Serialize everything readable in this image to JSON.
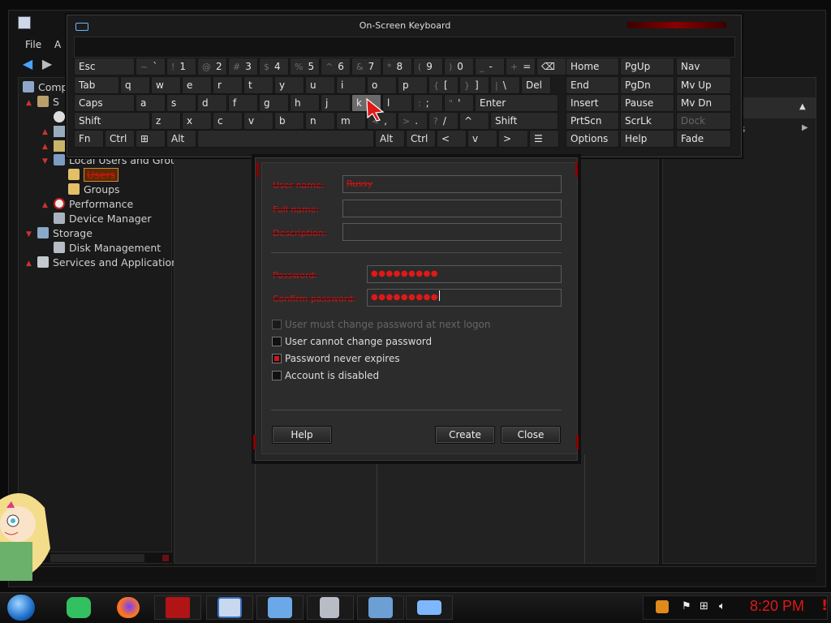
{
  "mmc": {
    "menu": {
      "file": "File",
      "action_partial": "A"
    },
    "tree": [
      {
        "label": "Comp",
        "icon": "computer-management-icon"
      },
      {
        "label": "S",
        "icon": "system-tools-icon"
      },
      {
        "label": "Local Users and Grou",
        "icon": "users-groups-icon"
      },
      {
        "label": "Users",
        "icon": "folder-icon",
        "selected": true
      },
      {
        "label": "Groups",
        "icon": "folder-icon"
      },
      {
        "label": "Performance",
        "icon": "performance-icon"
      },
      {
        "label": "Device Manager",
        "icon": "device-manager-icon"
      },
      {
        "label": "Storage",
        "icon": "storage-icon"
      },
      {
        "label": "Disk Management",
        "icon": "disk-management-icon"
      },
      {
        "label": "Services and Applications",
        "icon": "services-icon"
      }
    ],
    "actions_partial": "s"
  },
  "osk": {
    "title": "On-Screen Keyboard",
    "row1": [
      {
        "main": "Esc"
      },
      {
        "sub": "~",
        "main": "`"
      },
      {
        "sub": "!",
        "main": "1"
      },
      {
        "sub": "@",
        "main": "2"
      },
      {
        "sub": "#",
        "main": "3"
      },
      {
        "sub": "$",
        "main": "4"
      },
      {
        "sub": "%",
        "main": "5"
      },
      {
        "sub": "^",
        "main": "6"
      },
      {
        "sub": "&",
        "main": "7"
      },
      {
        "sub": "*",
        "main": "8"
      },
      {
        "sub": "(",
        "main": "9"
      },
      {
        "sub": ")",
        "main": "0"
      },
      {
        "sub": "_",
        "main": "-"
      },
      {
        "sub": "+",
        "main": "="
      },
      {
        "main": "⌫"
      }
    ],
    "row2": [
      {
        "main": "Tab"
      },
      {
        "main": "q"
      },
      {
        "main": "w"
      },
      {
        "main": "e"
      },
      {
        "main": "r"
      },
      {
        "main": "t"
      },
      {
        "main": "y"
      },
      {
        "main": "u"
      },
      {
        "main": "i"
      },
      {
        "main": "o"
      },
      {
        "main": "p"
      },
      {
        "sub": "{",
        "main": "["
      },
      {
        "sub": "}",
        "main": "]"
      },
      {
        "sub": "|",
        "main": "\\"
      },
      {
        "main": "Del"
      }
    ],
    "row3": [
      {
        "main": "Caps"
      },
      {
        "main": "a"
      },
      {
        "main": "s"
      },
      {
        "main": "d"
      },
      {
        "main": "f"
      },
      {
        "main": "g"
      },
      {
        "main": "h"
      },
      {
        "main": "j"
      },
      {
        "main": "k"
      },
      {
        "main": "l"
      },
      {
        "sub": ":",
        "main": ";"
      },
      {
        "sub": "\"",
        "main": "'"
      },
      {
        "main": "Enter"
      }
    ],
    "row4": [
      {
        "main": "Shift"
      },
      {
        "main": "z"
      },
      {
        "main": "x"
      },
      {
        "main": "c"
      },
      {
        "main": "v"
      },
      {
        "main": "b"
      },
      {
        "main": "n"
      },
      {
        "main": "m"
      },
      {
        "sub": "<",
        "main": ","
      },
      {
        "sub": ">",
        "main": "."
      },
      {
        "sub": "?",
        "main": "/"
      },
      {
        "main": "^"
      },
      {
        "main": "Shift"
      }
    ],
    "row5": [
      {
        "main": "Fn"
      },
      {
        "main": "Ctrl"
      },
      {
        "main": "⊞"
      },
      {
        "main": "Alt"
      },
      {
        "main": ""
      },
      {
        "main": "Alt"
      },
      {
        "main": "Ctrl"
      },
      {
        "main": "<"
      },
      {
        "main": "v"
      },
      {
        "main": ">"
      },
      {
        "main": "☰"
      }
    ],
    "nav": [
      [
        "Home",
        "PgUp",
        "Nav"
      ],
      [
        "End",
        "PgDn",
        "Mv Up"
      ],
      [
        "Insert",
        "Pause",
        "Mv Dn"
      ],
      [
        "PrtScn",
        "ScrLk",
        "Dock"
      ],
      [
        "Options",
        "Help",
        "Fade"
      ]
    ]
  },
  "dialog": {
    "labels": {
      "user_name": "User name:",
      "full_name": "Full name:",
      "description": "Description:",
      "password": "Password:",
      "confirm_password": "Confirm password:"
    },
    "values": {
      "user_name": "Russy",
      "full_name": "",
      "description": "",
      "password": "●●●●●●●●●",
      "confirm_password": "●●●●●●●●●"
    },
    "checkboxes": [
      {
        "label": "User must change password at next logon",
        "checked": false,
        "enabled": false
      },
      {
        "label": "User cannot change password",
        "checked": false,
        "enabled": true
      },
      {
        "label": "Password never expires",
        "checked": true,
        "enabled": true
      },
      {
        "label": "Account is disabled",
        "checked": false,
        "enabled": true
      }
    ],
    "buttons": {
      "help": "Help",
      "create": "Create",
      "close": "Close"
    }
  },
  "taskbar": {
    "clock": "8:20 PM",
    "tray_alert": "!",
    "pinned": [
      "start-orb-icon",
      "notes-app-icon",
      "firefox-icon",
      "media-app-icon",
      "computer-management-icon",
      "control-panel-icon",
      "server-lock-icon",
      "network-computer-icon",
      "keyboard-icon"
    ]
  },
  "colors": {
    "accent_red": "#d51414",
    "window_bg": "#141414",
    "dialog_bg": "#2c2c2c"
  }
}
